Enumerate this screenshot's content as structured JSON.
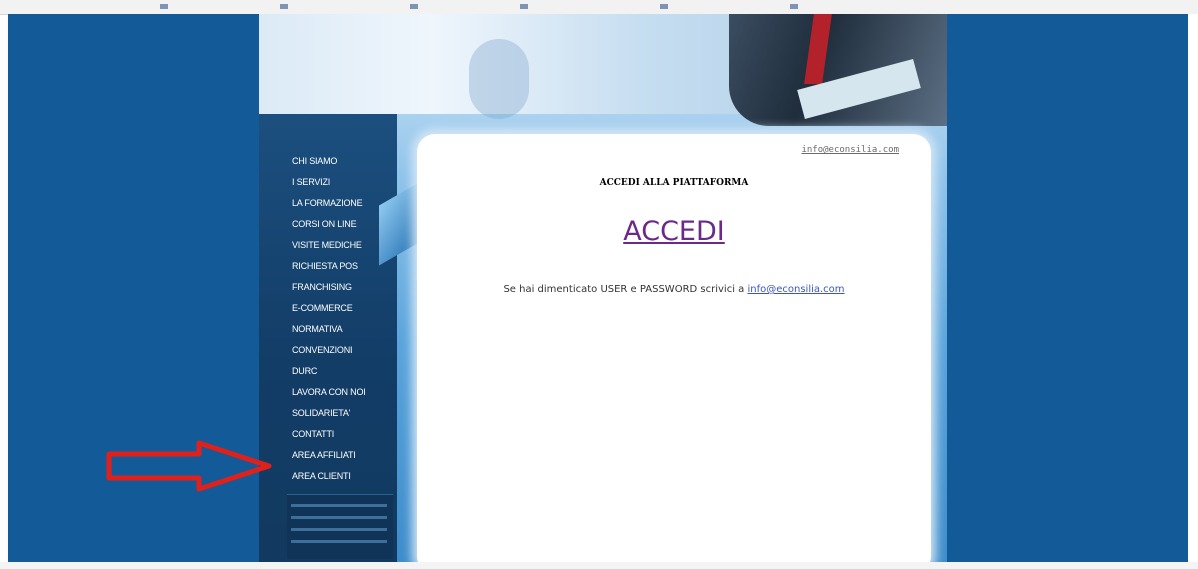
{
  "colors": {
    "page_background": "#135a98",
    "sidebar_background": "#123d67",
    "nav_text": "#ffffff",
    "accedi_link": "#6b2a8a",
    "email_link": "#3b56c4",
    "arrow_outline": "#e0201b"
  },
  "header": {
    "contact_email": "info@econsilia.com"
  },
  "sidebar": {
    "items": [
      {
        "label": "CHI SIAMO"
      },
      {
        "label": "I SERVIZI"
      },
      {
        "label": "LA FORMAZIONE"
      },
      {
        "label": "CORSI ON LINE"
      },
      {
        "label": "VISITE MEDICHE"
      },
      {
        "label": "RICHIESTA POS"
      },
      {
        "label": "FRANCHISING"
      },
      {
        "label": "E-COMMERCE"
      },
      {
        "label": "NORMATIVA"
      },
      {
        "label": "CONVENZIONI"
      },
      {
        "label": "DURC"
      },
      {
        "label": "LAVORA CON NOI"
      },
      {
        "label": "SOLIDARIETA'"
      },
      {
        "label": "CONTATTI"
      },
      {
        "label": "AREA AFFILIATI"
      },
      {
        "label": "AREA CLIENTI"
      }
    ]
  },
  "main": {
    "title": "ACCEDI ALLA PIATTAFORMA",
    "login_link": "ACCEDI",
    "forgot_text": "Se hai dimenticato USER e PASSWORD scrivici a",
    "forgot_email": "info@econsilia.com"
  },
  "annotation": {
    "icon": "red-arrow-icon",
    "points_to": "AREA CLIENTI"
  }
}
